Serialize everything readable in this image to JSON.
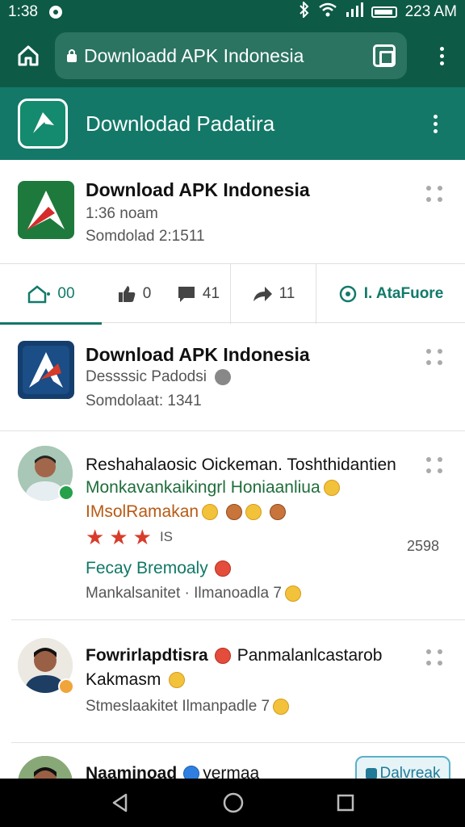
{
  "status_bar": {
    "time": "1:38",
    "clock_right": "223 AM",
    "icons": [
      "notification-dot-icon",
      "bluetooth-icon",
      "wifi-icon",
      "signal-icon",
      "battery-icon"
    ]
  },
  "browser": {
    "url": "Downloadd APK Indonesia",
    "home_icon": "home-icon",
    "lock_icon": "lock-icon",
    "tabs_icon": "tabs-icon",
    "menu_icon": "kebab-menu-icon"
  },
  "app_header": {
    "title": "Downlodad Padatira",
    "menu_icon": "kebab-menu-icon"
  },
  "app_rows": [
    {
      "title": "Download APK Indonesia",
      "meta1": "1:36 noam",
      "meta2": "Somdolad 2:1511"
    },
    {
      "title": "Download APK Indonesia",
      "meta1": "Dessssic Padodsi",
      "meta2": "Somdolaat: 1341"
    }
  ],
  "action_bar": [
    {
      "icon": "home-outline-icon",
      "count": "00"
    },
    {
      "icon": "thumbs-up-icon",
      "count": "0"
    },
    {
      "icon": "comment-icon",
      "count": "41"
    },
    {
      "icon": "share-icon",
      "count": "11"
    },
    {
      "icon": "refresh-icon",
      "label": "I. AtaFuore"
    }
  ],
  "comments": [
    {
      "line1": "Reshahalaosic Oickeman. Toshthidantien",
      "line2": "Monkavankaikingrl Honiaanliua",
      "line3": "IMsolRamakan",
      "rating": 3,
      "rating_suffix": "IS",
      "time": "2598",
      "line4": "Fecay Bremoaly",
      "line5": "Mankalsanitet · Ilmanoadla 7"
    },
    {
      "line1": "Fowrirlapdtisra",
      "line1b": "Panmalanlcastarob",
      "line2": "Kakmasm",
      "line3": "Stmeslaakitet  Ilmanpadle 7"
    },
    {
      "line1": "Naaminoad",
      "line1b": "yermaa",
      "reply": "Dalvreak"
    }
  ],
  "nav": {
    "back_icon": "back-triangle-icon",
    "home_icon": "home-circle-icon",
    "recents_icon": "recents-square-icon"
  },
  "colors": {
    "header_dark": "#0d5a46",
    "header": "#137868",
    "accent": "#137868",
    "star": "#d93c2a"
  }
}
